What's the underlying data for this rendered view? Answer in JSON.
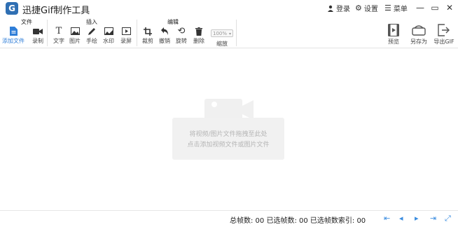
{
  "app": {
    "title": "迅捷Gif制作工具",
    "logo_letter": "G"
  },
  "titlebar": {
    "login_label": "登录",
    "settings_label": "设置",
    "menu_label": "菜单"
  },
  "toolbar": {
    "groups": {
      "file": "文件",
      "insert": "插入",
      "edit": "编辑"
    },
    "add_file": "添加文件",
    "record": "录制",
    "text": "文字",
    "image": "图片",
    "handdraw": "手绘",
    "watermark": "水印",
    "screen_record": "录屏",
    "crop": "裁剪",
    "undo": "撤销",
    "rotate": "旋转",
    "delete": "删除",
    "zoom_value": "100%",
    "zoom_label": "缩放",
    "preview": "预览",
    "save_as": "另存为",
    "export_gif": "导出GIF"
  },
  "canvas": {
    "hint_line1": "将视频/图片文件拖拽至此处",
    "hint_line2": "点击添加视频文件或图片文件"
  },
  "status": {
    "text": "总帧数: 00  已选帧数: 00  已选帧数索引: 00"
  },
  "colors": {
    "accent": "#2f7ed8",
    "logo": "#2f6fb3"
  }
}
